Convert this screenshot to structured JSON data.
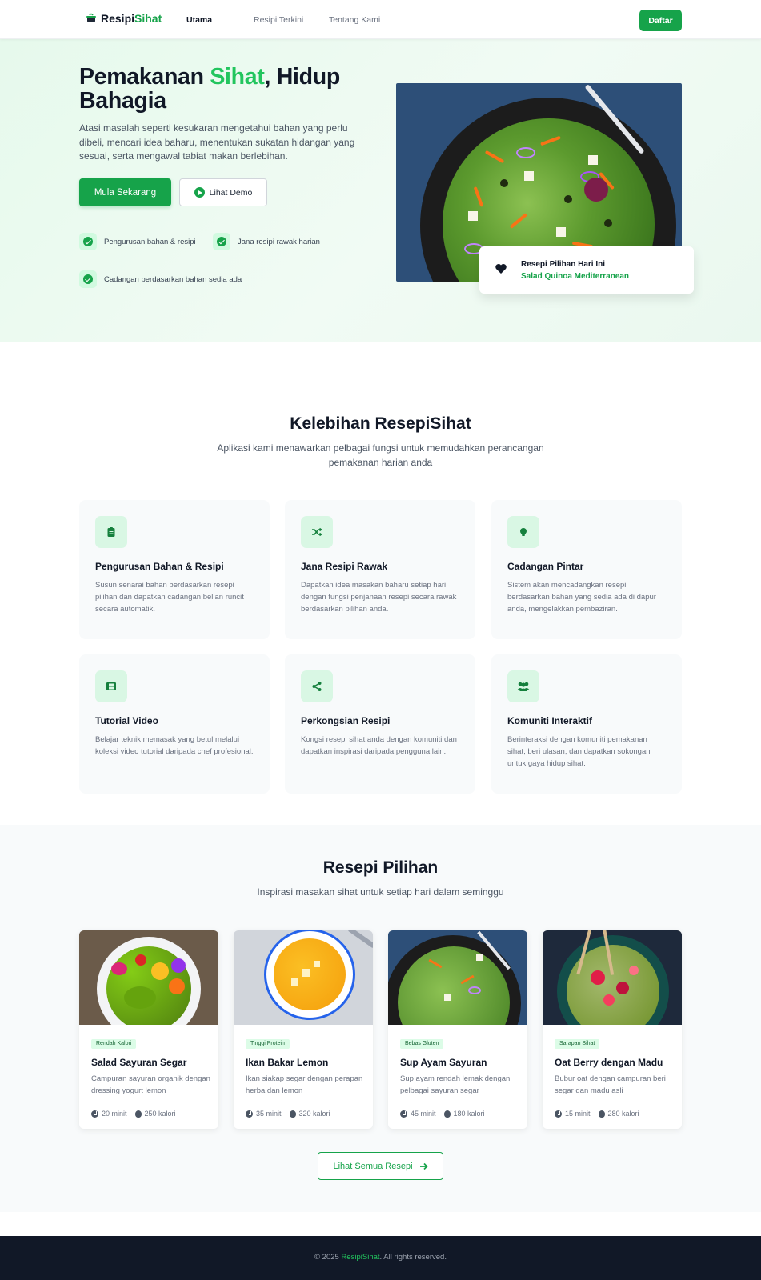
{
  "nav": {
    "logo_name_a": "Resipi",
    "logo_name_b": "Sihat",
    "links": [
      "Utama",
      "Resipi Terkini",
      "Tentang Kami"
    ],
    "signup": "Daftar"
  },
  "hero": {
    "title_a": "Pemakanan ",
    "title_green": "Sihat",
    "title_b": ", Hidup Bahagia",
    "desc": "Atasi masalah seperti kesukaran mengetahui bahan yang perlu dibeli, mencari idea baharu, menentukan sukatan hidangan yang sesuai, serta mengawal tabiat makan berlebihan.",
    "primary_btn": "Mula Sekarang",
    "secondary_btn": "Lihat Demo",
    "checks": [
      "Pengurusan bahan & resipi",
      "Jana resipi rawak harian",
      "Cadangan berdasarkan bahan sedia ada"
    ],
    "today_label": "Resepi Pilihan Hari Ini",
    "today_name": "Salad Quinoa Mediterranean"
  },
  "features": {
    "title": "Kelebihan ResepiSihat",
    "subtitle": "Aplikasi kami menawarkan pelbagai fungsi untuk memudahkan perancangan pemakanan harian anda",
    "items": [
      {
        "icon": "clipboard-icon",
        "title": "Pengurusan Bahan & Resipi",
        "desc": "Susun senarai bahan berdasarkan resepi pilihan dan dapatkan cadangan belian runcit secara automatik."
      },
      {
        "icon": "shuffle-icon",
        "title": "Jana Resipi Rawak",
        "desc": "Dapatkan idea masakan baharu setiap hari dengan fungsi penjanaan resepi secara rawak berdasarkan pilihan anda."
      },
      {
        "icon": "lightbulb-icon",
        "title": "Cadangan Pintar",
        "desc": "Sistem akan mencadangkan resepi berdasarkan bahan yang sedia ada di dapur anda, mengelakkan pembaziran."
      },
      {
        "icon": "film-icon",
        "title": "Tutorial Video",
        "desc": "Belajar teknik memasak yang betul melalui koleksi video tutorial daripada chef profesional."
      },
      {
        "icon": "share-icon",
        "title": "Perkongsian Resipi",
        "desc": "Kongsi resepi sihat anda dengan komuniti dan dapatkan inspirasi daripada pengguna lain."
      },
      {
        "icon": "users-icon",
        "title": "Komuniti Interaktif",
        "desc": "Berinteraksi dengan komuniti pemakanan sihat, beri ulasan, dan dapatkan sokongan untuk gaya hidup sihat."
      }
    ]
  },
  "recipes": {
    "title": "Resepi Pilihan",
    "subtitle": "Inspirasi masakan sihat untuk setiap hari dalam seminggu",
    "items": [
      {
        "tag": "Rendah Kalori",
        "name": "Salad Sayuran Segar",
        "desc": "Campuran sayuran organik dengan dressing yogurt lemon",
        "time": "20 minit",
        "cal": "250 kalori"
      },
      {
        "tag": "Tinggi Protein",
        "name": "Ikan Bakar Lemon",
        "desc": "Ikan siakap segar dengan perapan herba dan lemon",
        "time": "35 minit",
        "cal": "320 kalori"
      },
      {
        "tag": "Bebas Gluten",
        "name": "Sup Ayam Sayuran",
        "desc": "Sup ayam rendah lemak dengan pelbagai sayuran segar",
        "time": "45 minit",
        "cal": "180 kalori"
      },
      {
        "tag": "Sarapan Sihat",
        "name": "Oat Berry dengan Madu",
        "desc": "Bubur oat dengan campuran beri segar dan madu asli",
        "time": "15 minit",
        "cal": "280 kalori"
      }
    ],
    "view_all": "Lihat Semua Resepi"
  },
  "footer": {
    "prefix": "© 2025 ",
    "brand": "ResipiSihat",
    "suffix": ". All rights reserved."
  },
  "colors": {
    "accent": "#16a34a",
    "accent_light": "#22c55e",
    "footer_bg": "#111827"
  }
}
